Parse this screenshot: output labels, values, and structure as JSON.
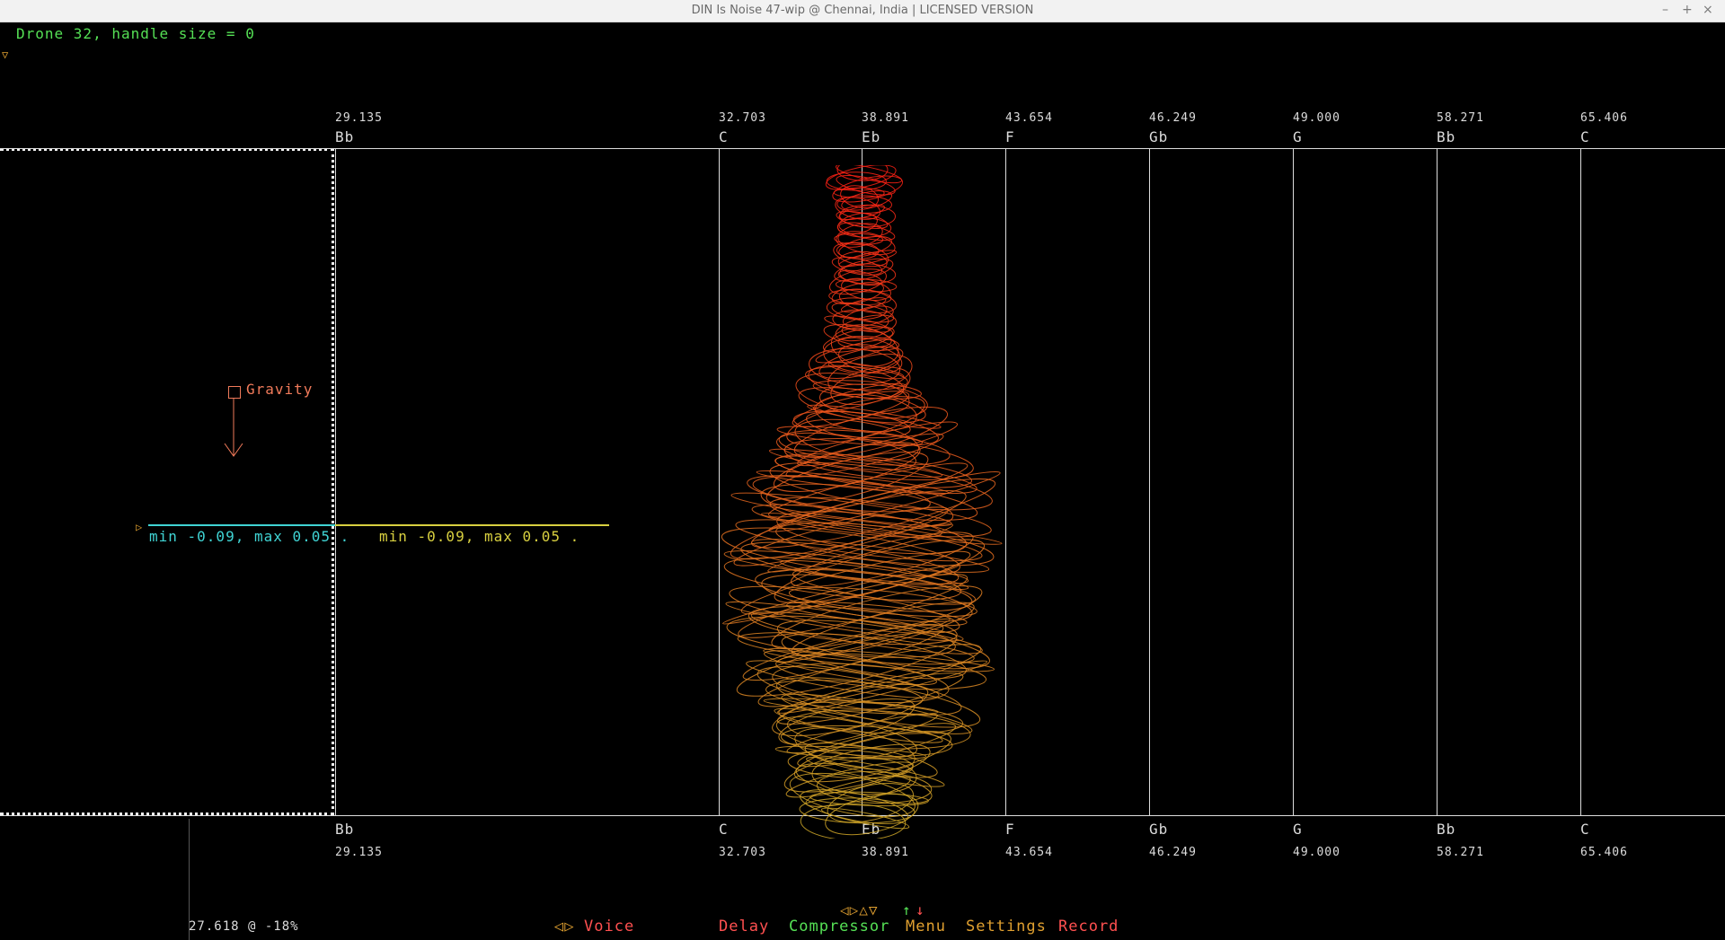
{
  "window": {
    "title": "DIN Is Noise 47-wip @ Chennai, India | LICENSED VERSION",
    "controls": {
      "minimize": "–",
      "maximize": "+",
      "close": "×"
    }
  },
  "header": {
    "drone_info": "Drone 32, handle size = 0",
    "menu_toggle_glyph": "▽"
  },
  "scale": {
    "top_frequencies": [
      "29.135",
      "32.703",
      "38.891",
      "43.654",
      "46.249",
      "49.000",
      "58.271",
      "65.406"
    ],
    "notes": [
      "Bb",
      "C",
      "Eb",
      "F",
      "Gb",
      "G",
      "Bb",
      "C"
    ],
    "bottom_frequencies": [
      "29.135",
      "32.703",
      "38.891",
      "43.654",
      "46.249",
      "49.000",
      "58.271",
      "65.406"
    ]
  },
  "gravity": {
    "label": "Gravity"
  },
  "range": {
    "marker_glyph": "▷",
    "left_text": "min -0.09, max 0.05 .",
    "right_text": "min -0.09, max 0.05 ."
  },
  "status": {
    "readout": "27.618 @ -18%"
  },
  "navigation": {
    "arrows": "◁▷△▽",
    "up": "↑",
    "down": "↓"
  },
  "menu": {
    "voice_arrows": "◁▷",
    "voice": "Voice",
    "delay": "Delay",
    "compressor": "Compressor",
    "menu": "Menu",
    "settings": "Settings",
    "record": "Record"
  },
  "colors": {
    "green": "#55e055",
    "orange": "#e0a030",
    "red": "#ff5050",
    "cyan": "#40d4d4",
    "yellow": "#d8d040",
    "salmon": "#f07a5a",
    "grid": "#dcdcdc"
  }
}
